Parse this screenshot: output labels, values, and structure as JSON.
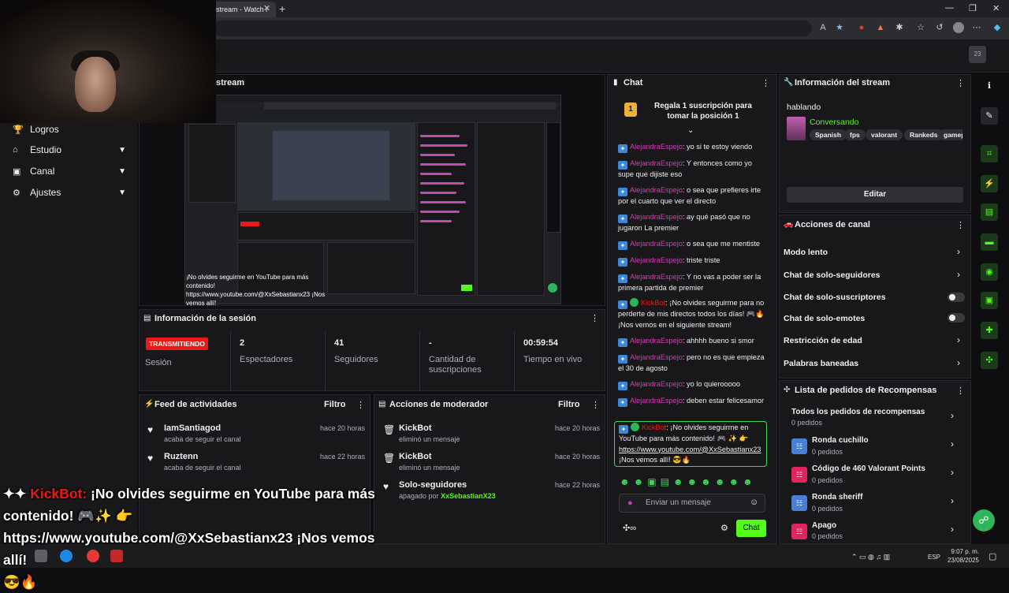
{
  "browser": {
    "tab_title": "stream - Watch l",
    "tab_close": "✕",
    "new_tab": "+",
    "win_min": "—",
    "win_max": "❐",
    "win_close": "✕"
  },
  "top_avatar": "23",
  "sidebar": {
    "items": [
      {
        "label": "Logros",
        "icon": "trophy-icon"
      },
      {
        "label": "Estudio",
        "icon": "studio-icon"
      },
      {
        "label": "Canal",
        "icon": "channel-icon"
      },
      {
        "label": "Ajustes",
        "icon": "gear-icon"
      }
    ]
  },
  "stream": {
    "title": "stream",
    "overlay_chat": "¡No olvides seguirme en YouTube para más contenido!",
    "overlay_link": "https://www.youtube.com/@XxSebastianx23 ¡Nos vemos allí!"
  },
  "session": {
    "title": "Información de la sesión",
    "badge": "TRANSMITIENDO",
    "badge_label": "Sesión",
    "stats": [
      {
        "value": "2",
        "label": "Espectadores"
      },
      {
        "value": "41",
        "label": "Seguidores"
      },
      {
        "value": "-",
        "label": "Cantidad de suscripciones"
      },
      {
        "value": "00:59:54",
        "label": "Tiempo en vivo"
      }
    ]
  },
  "activity_feed": {
    "title": "Feed de actividades",
    "filter": "Filtro",
    "items": [
      {
        "name": "IamSantiagod",
        "sub": "acaba de seguir el canal",
        "time": "hace 20 horas"
      },
      {
        "name": "Ruztenn",
        "sub": "acaba de seguir el canal",
        "time": "hace 22 horas"
      }
    ]
  },
  "mod_actions": {
    "title": "Acciones de moderador",
    "filter": "Filtro",
    "items": [
      {
        "name": "KickBot",
        "sub": "eliminó un mensaje",
        "time": "hace 20 horas"
      },
      {
        "name": "KickBot",
        "sub": "eliminó un mensaje",
        "time": "hace 20 horas"
      },
      {
        "name": "Solo-seguidores",
        "sub": "apagado por",
        "sub_user": "XxSebastianX23",
        "time": "hace 22 horas"
      }
    ]
  },
  "chat": {
    "title": "Chat",
    "sub_goal_rank": "1",
    "sub_goal": "Regala 1 suscripción para tomar la posición 1",
    "messages": [
      {
        "user": "AlejandraEspejo",
        "text": "yo si te estoy viendo"
      },
      {
        "user": "AlejandraEspejo",
        "text": "Y entonces como yo supe que dijiste eso"
      },
      {
        "user": "AlejandraEspejo",
        "text": "o sea que prefieres irte por el cuarto que ver el directo"
      },
      {
        "user": "AlejandraEspejo",
        "text": "ay qué pasó que no jugaron La premier"
      },
      {
        "user": "AlejandraEspejo",
        "text": "o sea que me mentiste"
      },
      {
        "user": "AlejandraEspejo",
        "text": "triste triste"
      },
      {
        "user": "AlejandraEspejo",
        "text": "Y no vas a poder ser la primera partida de premier"
      },
      {
        "user": "KickBot",
        "text": "¡No olvides seguirme para no perderte de mis directos todos los días! 🎮🔥 ¡Nos vemos en el siguiente stream!"
      },
      {
        "user": "AlejandraEspejo",
        "text": "ahhhh bueno si smor"
      },
      {
        "user": "AlejandraEspejo",
        "text": "pero no es que empieza el 30 de agosto"
      },
      {
        "user": "AlejandraEspejo",
        "text": "yo lo quierooooo"
      },
      {
        "user": "AlejandraEspejo",
        "text": "deben estar felicesamor"
      }
    ],
    "pinned": {
      "user": "KickBot",
      "text": "¡No olvides seguirme en YouTube para más contenido! 🎮 ✨ 👉",
      "link": "https://www.youtube.com/@XxSebastianx23",
      "tail": "¡Nos vemos allí! 😎🔥"
    },
    "input_placeholder": "Enviar un mensaje",
    "send_label": "Chat"
  },
  "stream_info": {
    "title": "Información del stream",
    "stream_title": "hablando",
    "category": "Conversando",
    "tags": [
      "Spanish",
      "fps",
      "valorant",
      "Rankeds",
      "gameplay"
    ],
    "edit_label": "Editar"
  },
  "channel_actions": {
    "title": "Acciones de canal",
    "rows": [
      {
        "label": "Modo lento",
        "control": "chevron"
      },
      {
        "label": "Chat de solo-seguidores",
        "control": "chevron"
      },
      {
        "label": "Chat de solo-suscriptores",
        "control": "toggle"
      },
      {
        "label": "Chat de solo-emotes",
        "control": "toggle"
      },
      {
        "label": "Restricción de edad",
        "control": "chevron"
      },
      {
        "label": "Palabras baneadas",
        "control": "chevron"
      }
    ]
  },
  "rewards": {
    "title": "Lista de pedidos de Recompensas",
    "items": [
      {
        "title": "Todos los pedidos de recompensas",
        "sub": "0 pedidos",
        "color": ""
      },
      {
        "title": "Ronda cuchillo",
        "sub": "0 pedidos",
        "color": "#4a7fd4"
      },
      {
        "title": "Código de 460 Valorant Points",
        "sub": "0 pedidos",
        "color": "#e0245e"
      },
      {
        "title": "Ronda sheriff",
        "sub": "0 pedidos",
        "color": "#4a7fd4"
      },
      {
        "title": "Apago",
        "sub": "0 pedidos",
        "color": "#e0245e"
      }
    ]
  },
  "overlay_caption": {
    "user": "KickBot:",
    "line1": "¡No olvides seguirme en YouTube para más contenido! 🎮✨ 👉",
    "line2": "https://www.youtube.com/@XxSebastianx23 ¡Nos vemos allí!",
    "line3": "😎🔥"
  },
  "taskbar": {
    "language": "ESP",
    "time": "9:07 p. m.",
    "date": "23/08/2025"
  },
  "colors": {
    "accent": "#53fc18",
    "live": "#e91916",
    "panel": "#18181b"
  }
}
